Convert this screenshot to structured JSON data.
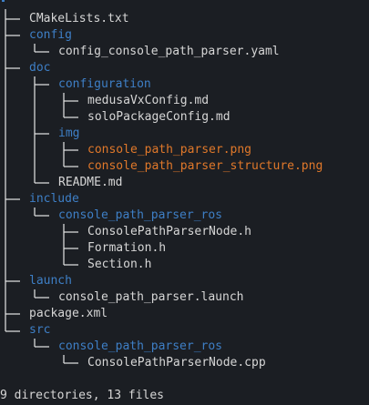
{
  "colors": {
    "background": "#1b1e23",
    "file": "#d6d6d6",
    "directory": "#3e7fc6",
    "image_file": "#e0782a",
    "tree_lines": "#e6e6e6"
  },
  "tree": {
    "cmakelists": "CMakeLists.txt",
    "config": "config",
    "config_yaml": "config_console_path_parser.yaml",
    "doc": "doc",
    "configuration": "configuration",
    "medusa": "medusaVxConfig.md",
    "solo": "soloPackageConfig.md",
    "img": "img",
    "png1": "console_path_parser.png",
    "png2": "console_path_parser_structure.png",
    "readme": "README.md",
    "include": "include",
    "include_pkg": "console_path_parser_ros",
    "node_h": "ConsolePathParserNode.h",
    "formation_h": "Formation.h",
    "section_h": "Section.h",
    "launch": "launch",
    "launch_file": "console_path_parser.launch",
    "package": "package.xml",
    "src": "src",
    "src_pkg": "console_path_parser_ros",
    "node_cpp": "ConsolePathParserNode.cpp"
  },
  "summary": "9 directories, 13 files"
}
